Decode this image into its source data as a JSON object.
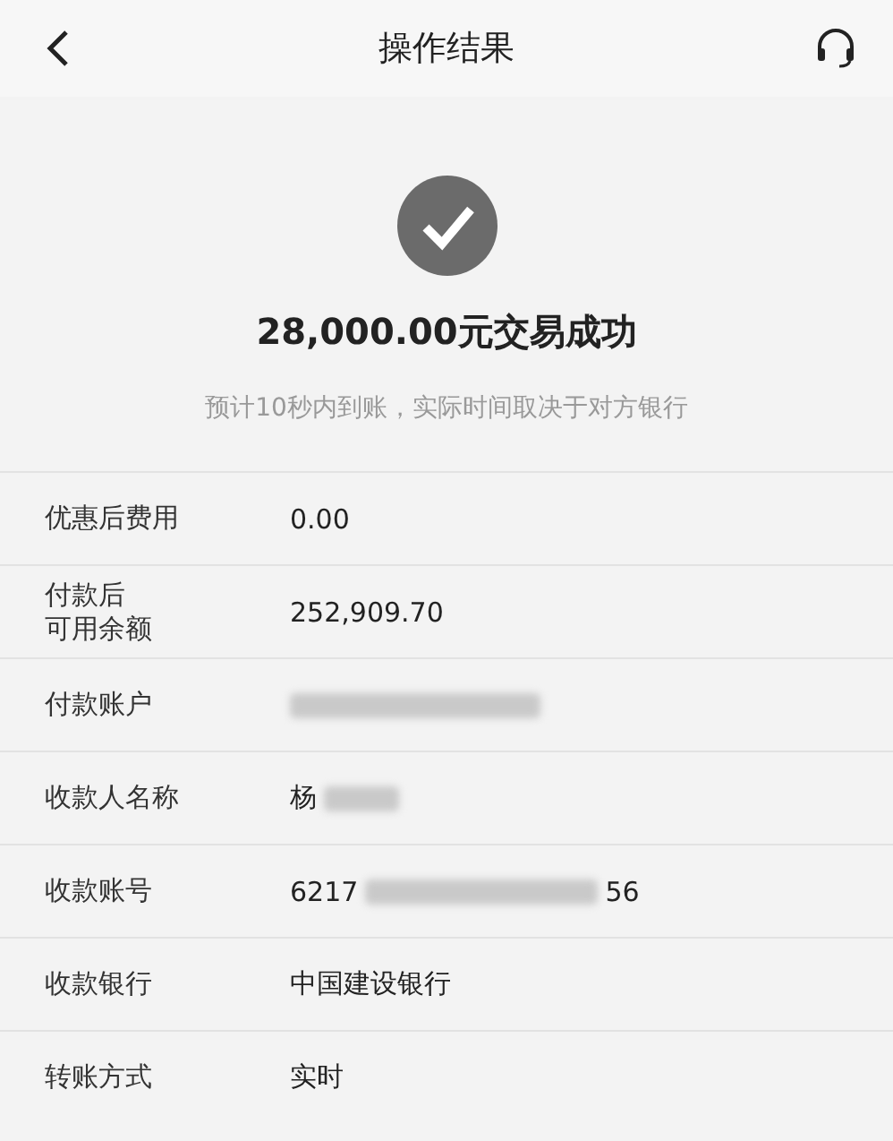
{
  "header": {
    "title": "操作结果"
  },
  "result": {
    "succeeded": true,
    "amount_text": "28,000.00元交易成功",
    "note": "预计10秒内到账，实际时间取决于对方银行"
  },
  "details": [
    {
      "label": "优惠后费用",
      "parts": [
        {
          "kind": "text",
          "text": "0.00"
        }
      ]
    },
    {
      "label": [
        "付款后",
        "可用余额"
      ],
      "parts": [
        {
          "kind": "text",
          "text": "252,909.70"
        }
      ]
    },
    {
      "label": "付款账户",
      "parts": [
        {
          "kind": "masked"
        }
      ]
    },
    {
      "label": "收款人名称",
      "parts": [
        {
          "kind": "text",
          "text": "杨"
        },
        {
          "kind": "masked"
        }
      ]
    },
    {
      "label": "收款账号",
      "parts": [
        {
          "kind": "text",
          "text": "6217"
        },
        {
          "kind": "masked"
        },
        {
          "kind": "text",
          "text": "56"
        }
      ]
    },
    {
      "label": "收款银行",
      "parts": [
        {
          "kind": "text",
          "text": "中国建设银行"
        }
      ]
    },
    {
      "label": "转账方式",
      "parts": [
        {
          "kind": "text",
          "text": "实时"
        }
      ]
    }
  ]
}
